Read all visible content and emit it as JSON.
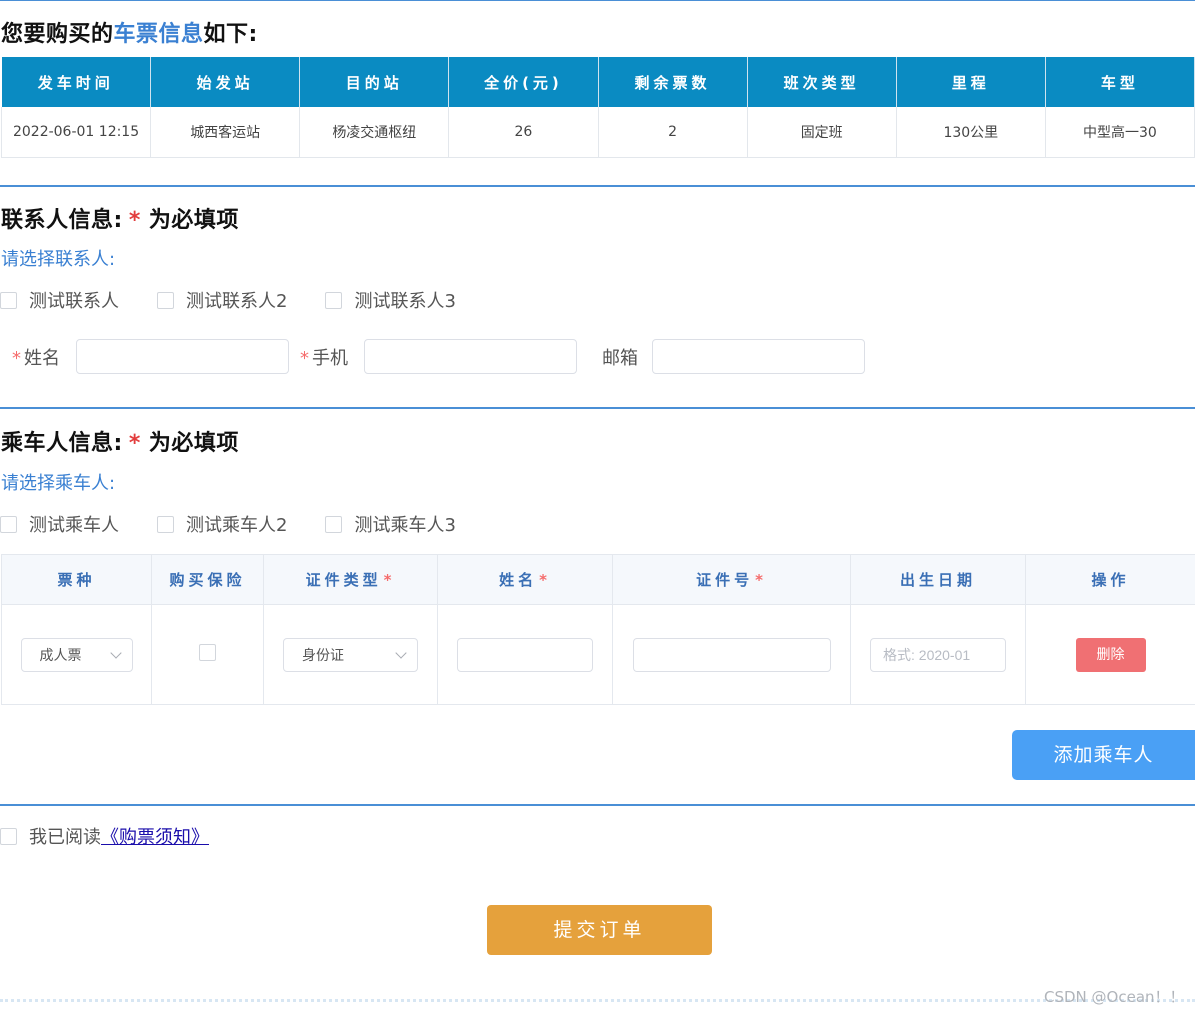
{
  "ticket_section": {
    "title_prefix": "您要购买的",
    "title_highlight": "车票信息",
    "title_suffix": "如下:",
    "headers": [
      "发车时间",
      "始发站",
      "目的站",
      "全价(元)",
      "剩余票数",
      "班次类型",
      "里程",
      "车型"
    ],
    "row": [
      "2022-06-01 12:15",
      "城西客运站",
      "杨凌交通枢纽",
      "26",
      "2",
      "固定班",
      "130公里",
      "中型高一30"
    ]
  },
  "contact_section": {
    "title": "联系人信息:",
    "required_star": "*",
    "required_note": "为必填项",
    "select_prompt": "请选择联系人:",
    "options": [
      "测试联系人",
      "测试联系人2",
      "测试联系人3"
    ],
    "fields": {
      "name_star": "*",
      "name_label": "姓名",
      "phone_star": "*",
      "phone_label": "手机",
      "email_label": "邮箱"
    }
  },
  "passenger_section": {
    "title": "乘车人信息:",
    "required_star": "*",
    "required_note": "为必填项",
    "select_prompt": "请选择乘车人:",
    "options": [
      "测试乘车人",
      "测试乘车人2",
      "测试乘车人3"
    ],
    "table_headers": {
      "ticket_type": "票种",
      "insurance": "购买保险",
      "id_type": "证件类型",
      "name": "姓名",
      "id_number": "证件号",
      "birthdate": "出生日期",
      "action": "操作"
    },
    "required_mark": "*",
    "row": {
      "ticket_type_value": "成人票",
      "id_type_value": "身份证",
      "birthdate_placeholder": "格式: 2020-01",
      "delete_label": "删除"
    },
    "add_button": "添加乘车人"
  },
  "agreement": {
    "prefix": "我已阅读",
    "link": "《购票须知》"
  },
  "submit_button": "提交订单",
  "watermark": "CSDN @Ocean！！",
  "colors": {
    "accent": "#3a80d2",
    "table_header": "#0a8bc2",
    "delete": "#f07073",
    "add": "#4aa0f5",
    "submit": "#e5a13c",
    "required": "#e23c3c"
  }
}
